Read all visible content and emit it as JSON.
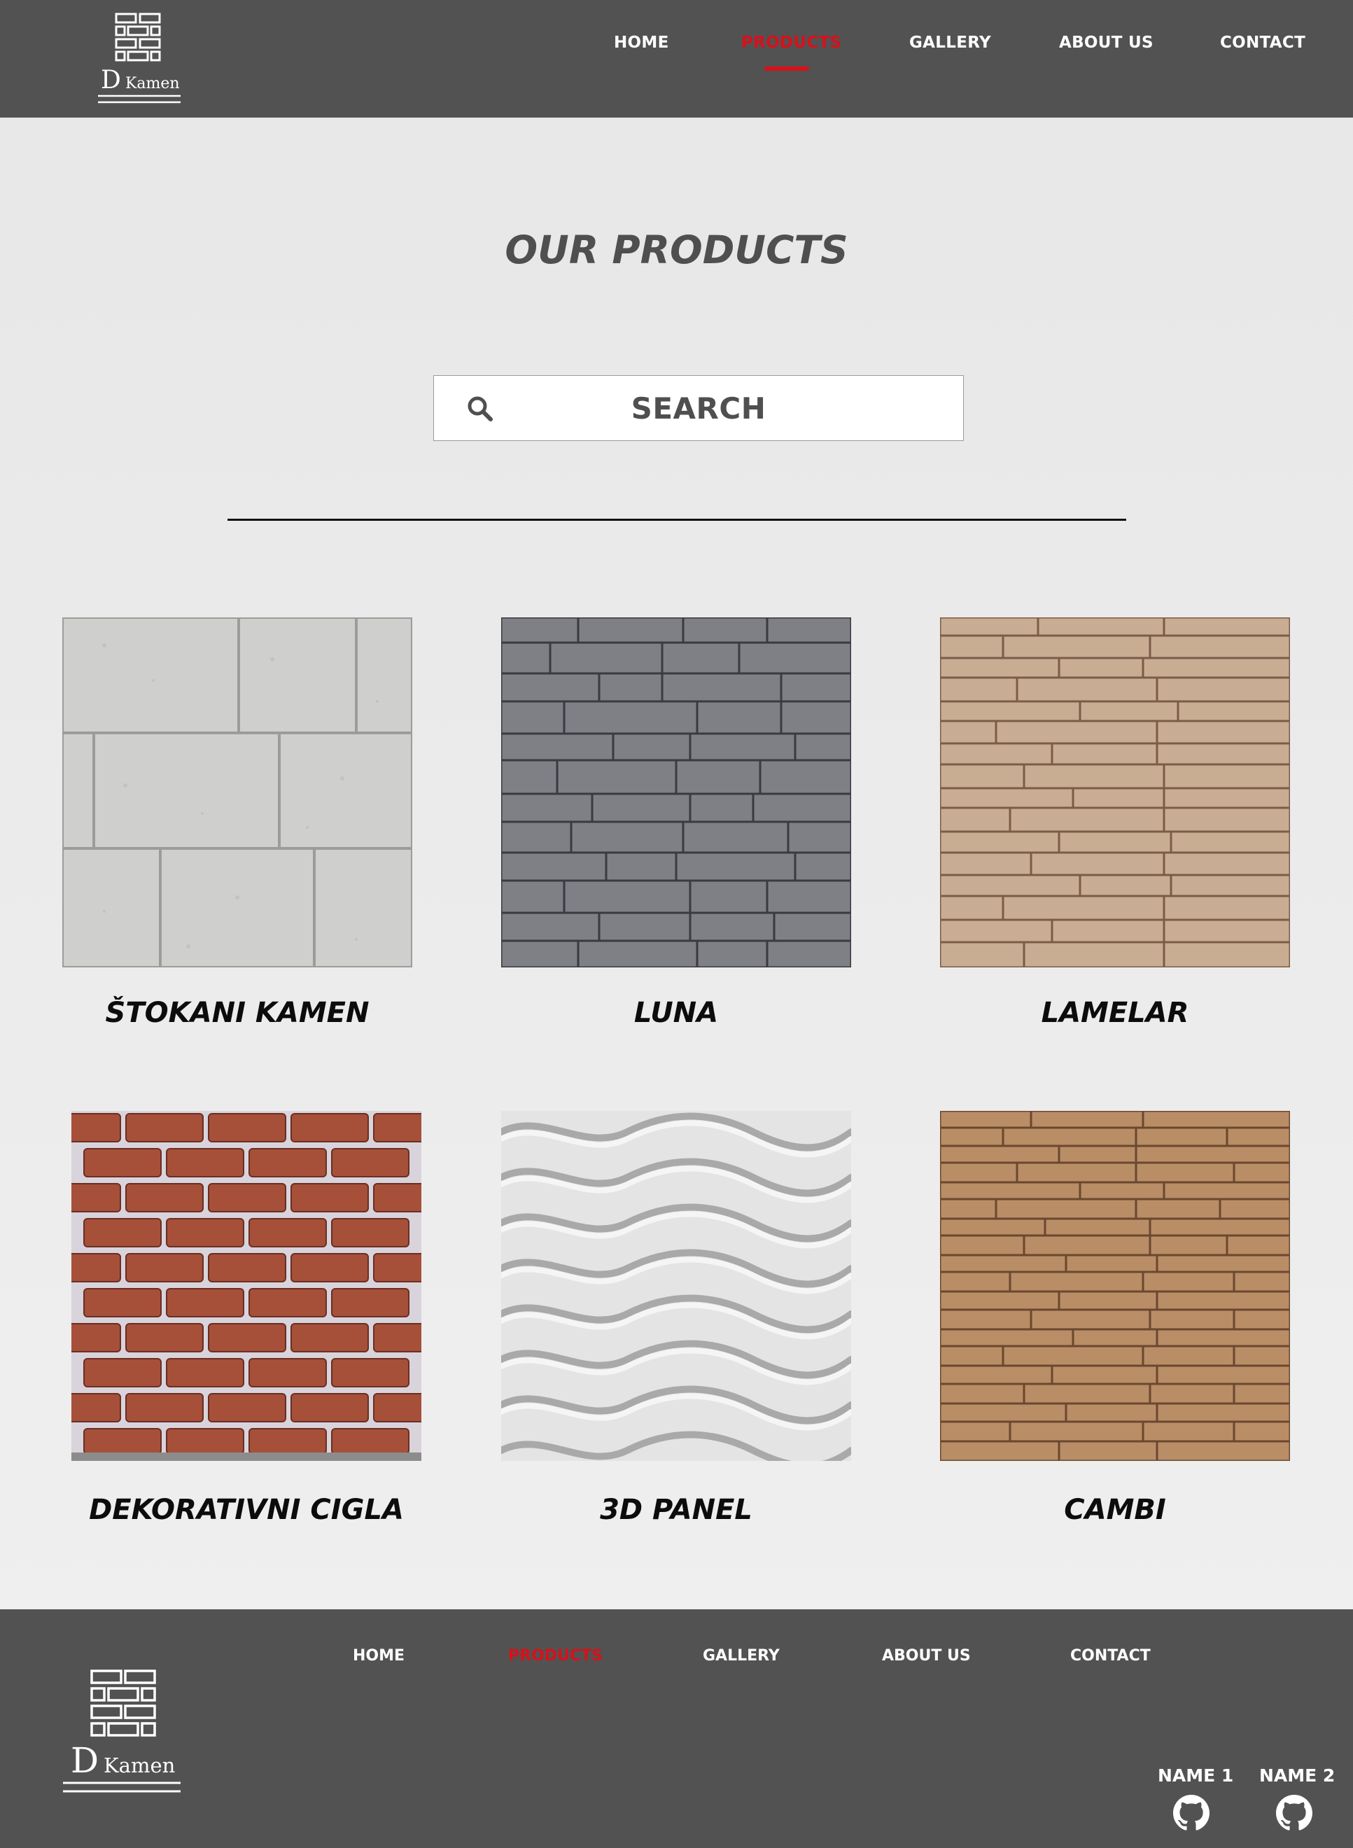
{
  "brand": {
    "logo_letter": "D",
    "logo_word": "Kamen"
  },
  "nav": {
    "items": [
      {
        "label": "HOME"
      },
      {
        "label": "PRODUCTS",
        "active": true
      },
      {
        "label": "GALLERY"
      },
      {
        "label": "ABOUT US"
      },
      {
        "label": "CONTACT"
      }
    ]
  },
  "main": {
    "title": "OUR PRODUCTS",
    "search": {
      "label": "SEARCH",
      "icon": "search-icon"
    },
    "products": [
      {
        "name": "ŠTOKANI KAMEN",
        "texture": "cut-stone-blocks"
      },
      {
        "name": "LUNA",
        "texture": "grey-stacked-slate"
      },
      {
        "name": "LAMELAR",
        "texture": "beige-layered-stone"
      },
      {
        "name": "DEKORATIVNI CIGLA",
        "texture": "red-brick"
      },
      {
        "name": "3D PANEL",
        "texture": "white-wave-panel"
      },
      {
        "name": "CAMBI",
        "texture": "brown-stacked-stone"
      }
    ]
  },
  "footer": {
    "nav": [
      {
        "label": "HOME"
      },
      {
        "label": "PRODUCTS",
        "active": true
      },
      {
        "label": "GALLERY"
      },
      {
        "label": "ABOUT US"
      },
      {
        "label": "CONTACT"
      }
    ],
    "authors": [
      {
        "name": "NAME 1",
        "icon": "github-icon"
      },
      {
        "name": "NAME 2",
        "icon": "github-icon"
      }
    ]
  },
  "colors": {
    "header_bg": "#525253",
    "accent": "#d9101a",
    "page_bg": "#ebeaeb",
    "title": "#4f4f50"
  }
}
